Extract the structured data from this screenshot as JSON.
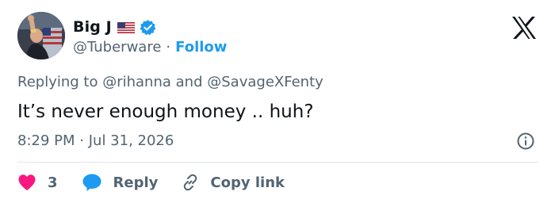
{
  "user": {
    "display_name": "Big J",
    "handle": "@Tuberware",
    "separator": "·",
    "follow_label": "Follow"
  },
  "tweet": {
    "reply_prefix": "Replying to",
    "reply_user_1": "@rihanna",
    "reply_and": "and",
    "reply_user_2": "@SavageXFenty",
    "text": "It’s never enough money .. huh?",
    "time": "8:29 PM",
    "date": "Jul 31, 2026"
  },
  "actions": {
    "like_count": "3",
    "reply_label": "Reply",
    "copy_label": "Copy link"
  },
  "icons": {
    "brand": "x-logo-icon",
    "verified": "verified-badge-icon",
    "flag": "us-flag-icon",
    "info": "info-icon",
    "like": "heart-icon",
    "reply": "reply-bubble-icon",
    "copy": "link-icon"
  },
  "colors": {
    "accent": "#1d9bf0",
    "heart": "#f91880",
    "muted_text": "#536471",
    "text": "#0f1419",
    "divider": "#e1e5e8"
  }
}
